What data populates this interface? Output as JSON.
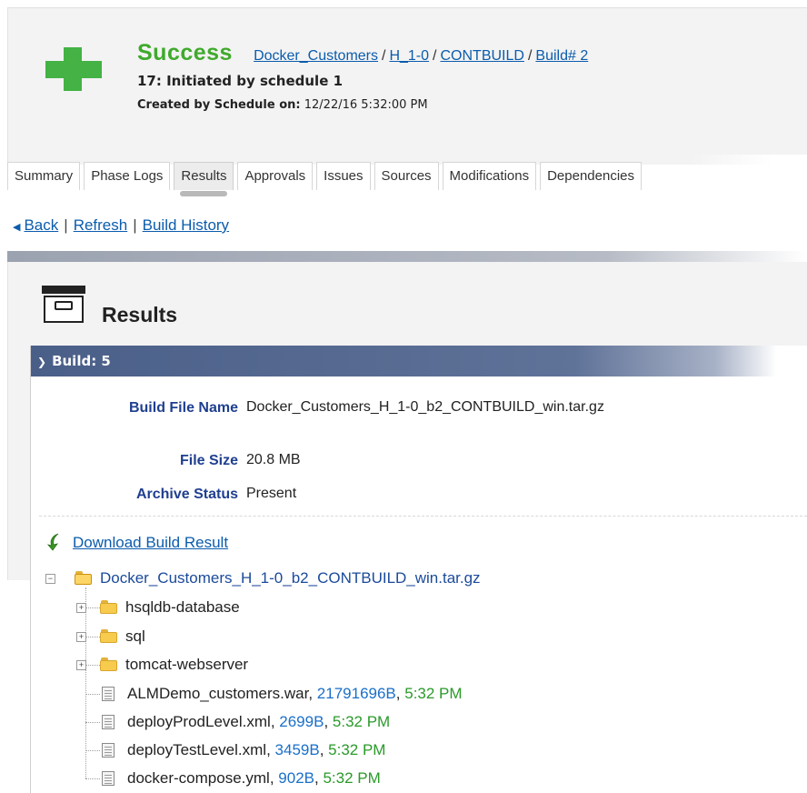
{
  "header": {
    "status": "Success",
    "breadcrumb": [
      "Docker_Customers",
      "H_1-0",
      "CONTBUILD",
      "Build# 2"
    ],
    "initiated": "17: Initiated by schedule 1",
    "created_label": "Created by Schedule on:",
    "created_value": "12/22/16 5:32:00 PM",
    "status_icon": "plus-icon",
    "status_color": "#44b245"
  },
  "tabs": [
    "Summary",
    "Phase Logs",
    "Results",
    "Approvals",
    "Issues",
    "Sources",
    "Modifications",
    "Dependencies"
  ],
  "active_tab": "Results",
  "nav": {
    "back": "Back",
    "refresh": "Refresh",
    "history": "Build History"
  },
  "results": {
    "title": "Results",
    "section_header": "Build: 5",
    "properties": [
      {
        "label": "Build File Name",
        "value": "Docker_Customers_H_1-0_b2_CONTBUILD_win.tar.gz"
      },
      {
        "label": "File Size",
        "value": "20.8 MB"
      },
      {
        "label": "Archive Status",
        "value": "Present"
      }
    ],
    "download_label": "Download Build Result"
  },
  "tree": {
    "root": "Docker_Customers_H_1-0_b2_CONTBUILD_win.tar.gz",
    "folders": [
      "hsqldb-database",
      "sql",
      "tomcat-webserver"
    ],
    "files": [
      {
        "name": "ALMDemo_customers.war",
        "size": "21791696B",
        "time": "5:32 PM"
      },
      {
        "name": "deployProdLevel.xml",
        "size": "2699B",
        "time": "5:32 PM"
      },
      {
        "name": "deployTestLevel.xml",
        "size": "3459B",
        "time": "5:32 PM"
      },
      {
        "name": "docker-compose.yml",
        "size": "902B",
        "time": "5:32 PM"
      }
    ]
  }
}
